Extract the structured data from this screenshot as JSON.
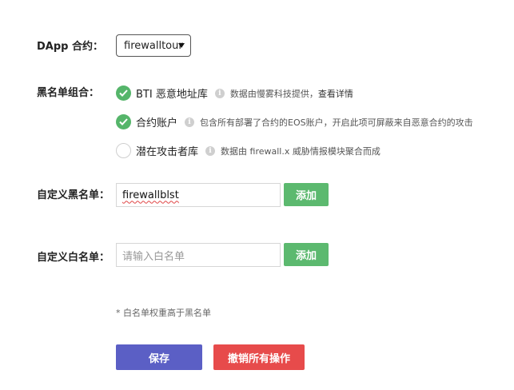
{
  "contract": {
    "label": "DApp 合约：",
    "selected": "firewalltour"
  },
  "blacklist_group": {
    "label": "黑名单组合：",
    "options": [
      {
        "name": "BTI 恶意地址库",
        "checked": true,
        "desc": "数据由慢雾科技提供，",
        "link": "查看详情"
      },
      {
        "name": "合约账户",
        "checked": true,
        "desc": "包含所有部署了合约的EOS账户，开启此项可屏蔽来自恶意合约的攻击"
      },
      {
        "name": "潜在攻击者库",
        "checked": false,
        "desc": "数据由 firewall.x 威胁情报模块聚合而成"
      }
    ]
  },
  "custom_blacklist": {
    "label": "自定义黑名单：",
    "value": "firewallblst",
    "add_label": "添加"
  },
  "custom_whitelist": {
    "label": "自定义白名单：",
    "placeholder": "请输入白名单",
    "add_label": "添加"
  },
  "note": "* 白名单权重高于黑名单",
  "actions": {
    "save_label": "保存",
    "undo_label": "撤销所有操作"
  },
  "colors": {
    "check_green": "#55b56a",
    "add_button": "#5cb96f",
    "save_button": "#5b5fc5",
    "undo_button": "#e74b4b"
  }
}
